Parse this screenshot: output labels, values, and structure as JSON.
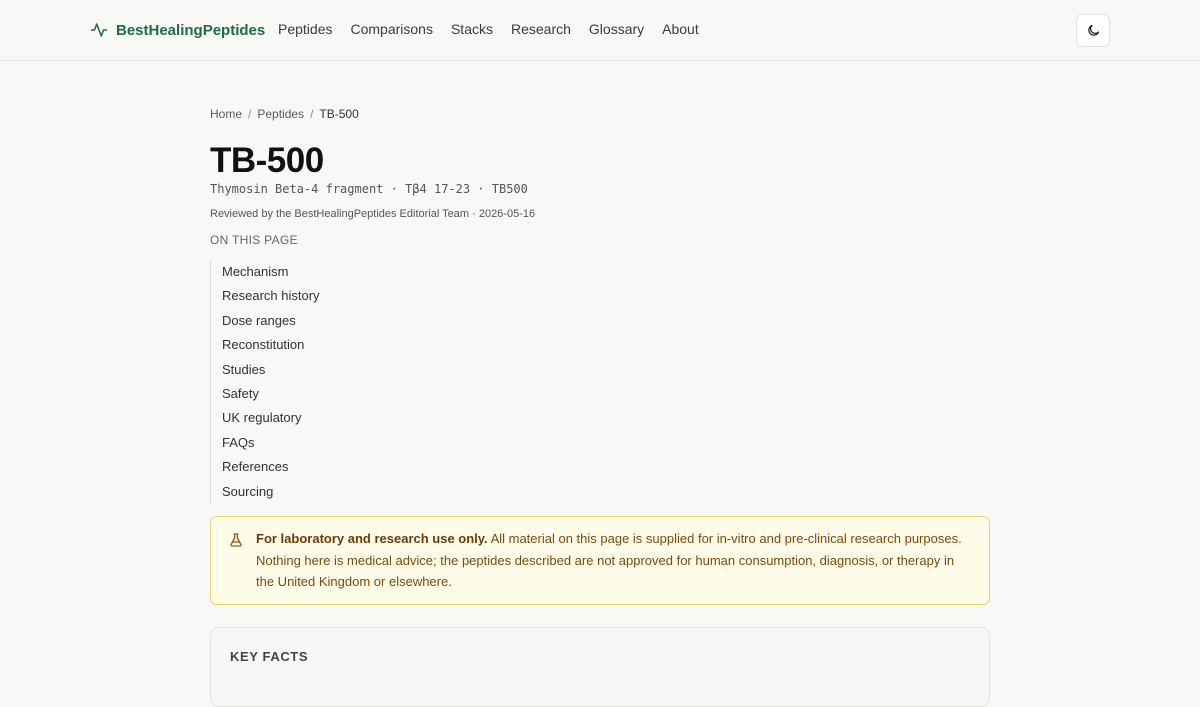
{
  "header": {
    "brand": "BestHealingPeptides",
    "nav": [
      "Peptides",
      "Comparisons",
      "Stacks",
      "Research",
      "Glossary",
      "About"
    ]
  },
  "breadcrumb": {
    "home": "Home",
    "section": "Peptides",
    "current": "TB-500",
    "separator": "/"
  },
  "page": {
    "title": "TB-500",
    "aliases": "Thymosin Beta-4 fragment · Tβ4 17-23 · TB500",
    "reviewed": "Reviewed by the BestHealingPeptides Editorial Team · 2026-05-16"
  },
  "toc": {
    "label": "ON THIS PAGE",
    "items": [
      "Mechanism",
      "Research history",
      "Dose ranges",
      "Reconstitution",
      "Studies",
      "Safety",
      "UK regulatory",
      "FAQs",
      "References",
      "Sourcing"
    ]
  },
  "notice": {
    "icon": "flask-icon",
    "bold": "For laboratory and research use only.",
    "text": " All material on this page is supplied for in-vitro and pre-clinical research purposes. Nothing here is medical advice; the peptides described are not approved for human consumption, diagnosis, or therapy in the United Kingdom or elsewhere."
  },
  "facts": {
    "title": "KEY FACTS"
  },
  "colors": {
    "brand": "#1f6b45",
    "notice_bg": "#fefce8",
    "notice_border": "#ecd56a",
    "notice_text": "#7a4a10"
  }
}
